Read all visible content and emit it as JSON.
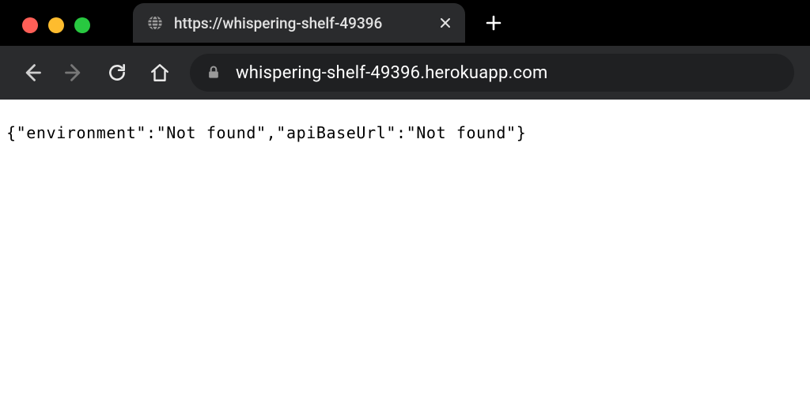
{
  "window": {
    "traffic_lights": [
      "close",
      "minimize",
      "maximize"
    ]
  },
  "tabs": {
    "items": [
      {
        "title": "https://whispering-shelf-49396",
        "favicon": "globe"
      }
    ],
    "new_tab_tooltip": "New Tab"
  },
  "toolbar": {
    "url": "whispering-shelf-49396.herokuapp.com",
    "secure": true
  },
  "page": {
    "bodyText": "{\"environment\":\"Not found\",\"apiBaseUrl\":\"Not found\"}"
  }
}
